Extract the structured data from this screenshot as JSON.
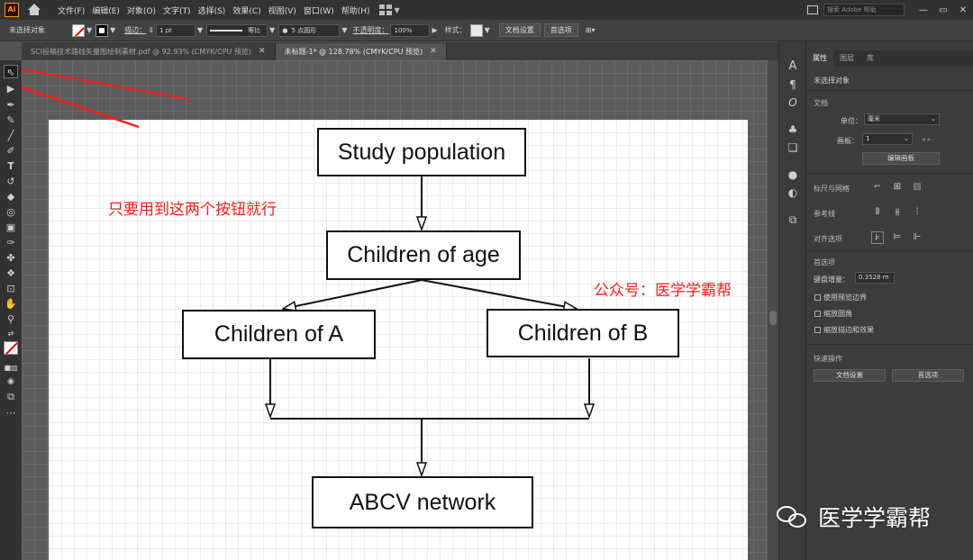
{
  "app": {
    "logo_text": "Ai"
  },
  "menus": [
    "文件(F)",
    "编辑(E)",
    "对象(O)",
    "文字(T)",
    "选择(S)",
    "效果(C)",
    "视图(V)",
    "窗口(W)",
    "帮助(H)"
  ],
  "search": {
    "placeholder": "搜索 Adobe 帮助"
  },
  "window_controls": {
    "minimize": "—",
    "restore": "▭",
    "close": "✕"
  },
  "controlbar": {
    "selection_status": "未选择对象",
    "stroke_label": "描边：",
    "stroke_weight": "1 pt",
    "profile_label": "等比",
    "brush_label": "5 点圆形",
    "opacity_label": "不透明度：",
    "opacity_value": "100%",
    "style_label": "样式：",
    "doc_setup_button": "文档设置",
    "preferences_button": "首选项"
  },
  "tabs": [
    {
      "label": "SCI投稿技术路线矢量图绘制素材.pdf @ 92.93% (CMYK/CPU 预览)",
      "active": false
    },
    {
      "label": "未标题-1* @ 128.78% (CMYK/CPU 预览)",
      "active": true
    }
  ],
  "tab_close_glyph": "✕",
  "canvas": {
    "annotation": "只要用到这两个按钮就行",
    "credit": "公众号：医学学霸帮",
    "annotation_color": "#ff1a1a"
  },
  "flowchart": {
    "nodes": {
      "study": "Study population",
      "age": "Children of age",
      "a": "Children of A",
      "b": "Children of B",
      "network": "ABCV network"
    }
  },
  "panel": {
    "tabs": [
      "属性",
      "图层",
      "库"
    ],
    "no_selection": "未选择对象",
    "document_section": "文档",
    "units_label": "单位：",
    "units_value": "毫米",
    "artboard_label": "画板：",
    "artboard_value": "1",
    "edit_artboards_button": "编辑画板",
    "rulers_grids_label": "标尺与网格",
    "guides_label": "参考线",
    "align_label": "对齐选项",
    "preferences_section": "首选项",
    "keyboard_increment_label": "键盘增量：",
    "keyboard_increment_value": "0.3528 m",
    "checkboxes": [
      "使用预览边界",
      "缩放圆角",
      "缩放描边和效果"
    ],
    "quick_actions_section": "快速操作",
    "doc_setup_button": "文档设置",
    "preferences_button": "首选项"
  },
  "watermark": {
    "text": "医学学霸帮"
  }
}
